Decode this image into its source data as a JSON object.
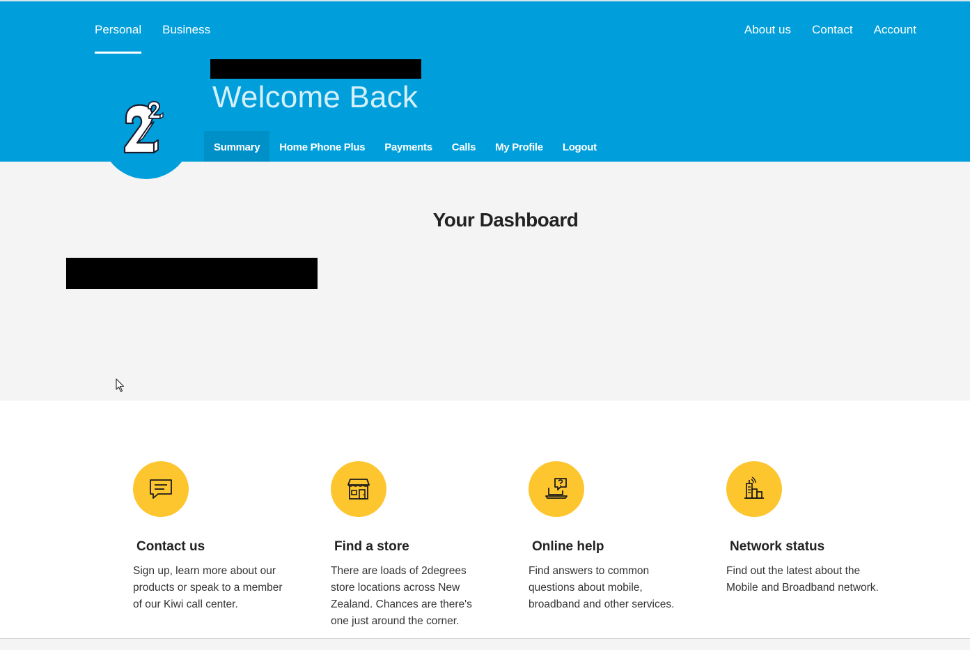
{
  "topnav": {
    "left": [
      "Personal",
      "Business"
    ],
    "right": [
      "About us",
      "Contact",
      "Account"
    ]
  },
  "header": {
    "welcome": "Welcome Back"
  },
  "subnav": [
    "Summary",
    "Home Phone Plus",
    "Payments",
    "Calls",
    "My Profile",
    "Logout"
  ],
  "dashboard": {
    "title": "Your Dashboard"
  },
  "cards": [
    {
      "icon": "chat-bubble-icon",
      "title": "Contact us",
      "text": "Sign up, learn more about our products or speak to a member of our Kiwi call center."
    },
    {
      "icon": "store-icon",
      "title": "Find a store",
      "text": "There are loads of 2degrees store locations across New Zealand. Chances are there's one just around the corner."
    },
    {
      "icon": "laptop-help-icon",
      "title": "Online help",
      "text": "Find answers to common questions about mobile, broadband and other services."
    },
    {
      "icon": "network-tower-icon",
      "title": "Network status",
      "text": "Find out the latest about the Mobile and Broadband network."
    }
  ],
  "colors": {
    "brand_blue": "#009fdb",
    "accent_yellow": "#fdc52e",
    "background_grey": "#f4f4f4"
  }
}
